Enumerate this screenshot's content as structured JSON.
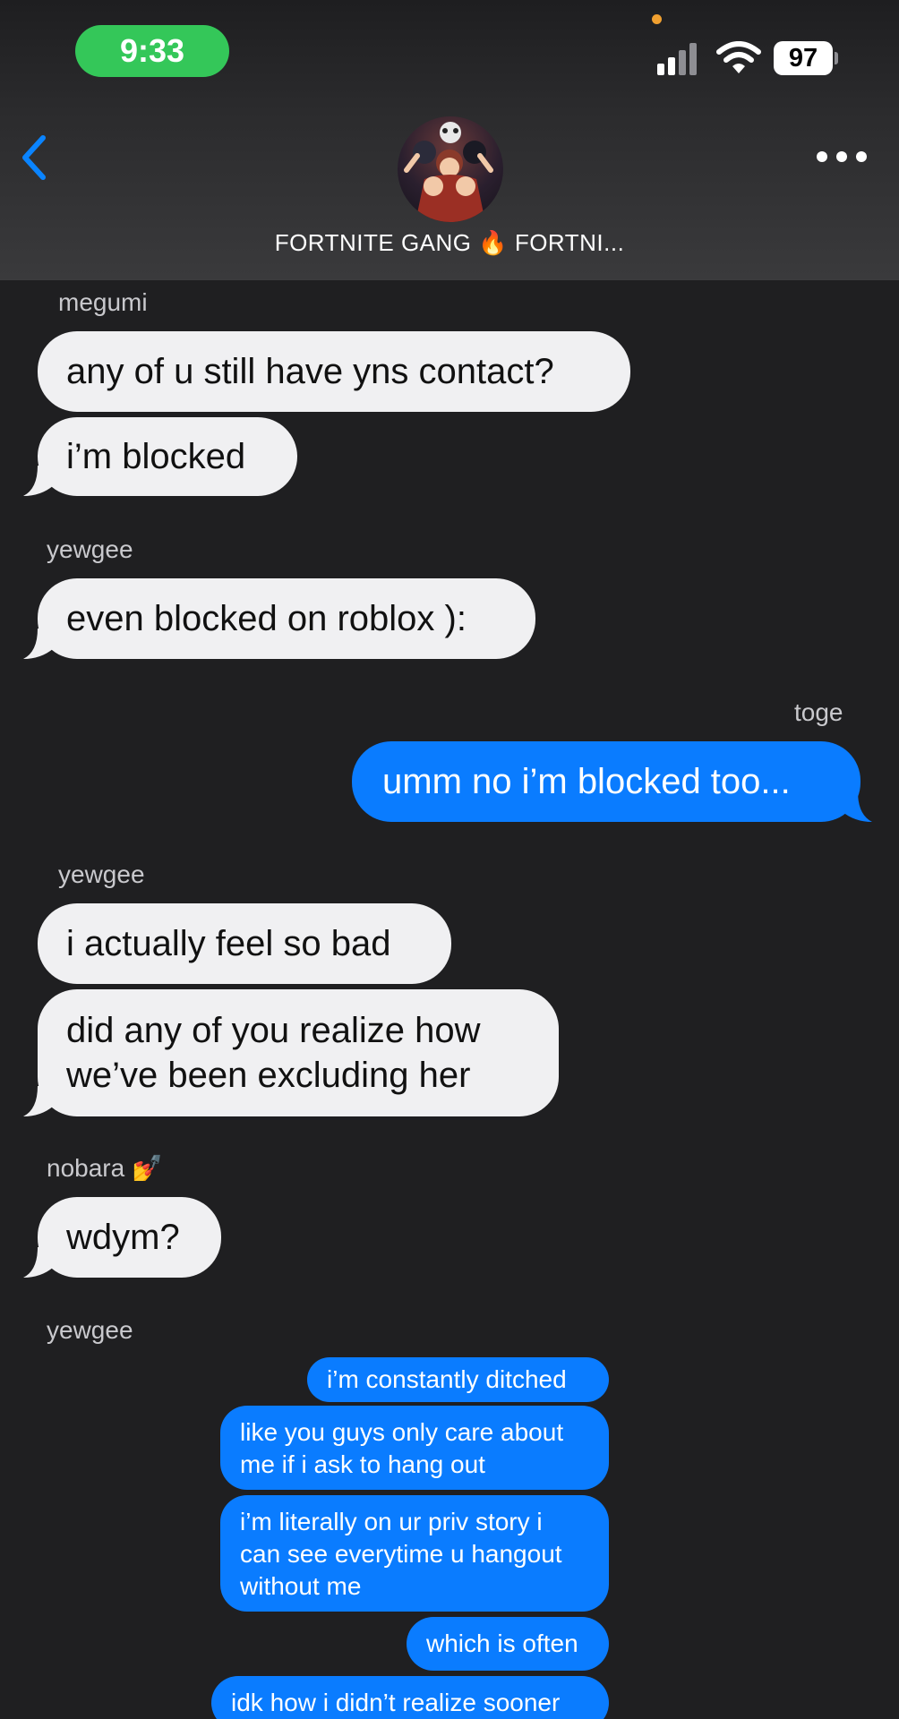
{
  "status_bar": {
    "time": "9:33",
    "battery": "97"
  },
  "header": {
    "group_name": "FORTNITE GANG 🔥 FORTNI..."
  },
  "messages": [
    {
      "sender": "megumi",
      "bubbles": [
        "any of u still have yns contact?",
        "i’m blocked"
      ],
      "side": "left"
    },
    {
      "sender": "yewgee",
      "bubbles": [
        "even blocked on roblox ):"
      ],
      "side": "left"
    },
    {
      "sender": "toge",
      "bubbles": [
        "umm no i’m blocked too..."
      ],
      "side": "right"
    },
    {
      "sender": "yewgee",
      "bubbles": [
        "i actually feel so bad",
        "did any of you realize how we’ve been excluding her"
      ],
      "side": "left"
    },
    {
      "sender": "nobara 💅",
      "bubbles": [
        "wdym?"
      ],
      "side": "left"
    },
    {
      "sender": "yewgee",
      "bubbles": [
        "i’m constantly ditched",
        "like you guys only care about me if i ask to hang out",
        "i’m literally on ur priv story i can see everytime u hangout without me",
        "which is often",
        "idk how i didn’t realize sooner"
      ],
      "side": "embedded"
    }
  ],
  "colors": {
    "incoming_bubble": "#f0f0f2",
    "outgoing_bubble": "#0a7cff",
    "background": "#1f1f21",
    "accent": "#0a84ff",
    "time_pill": "#34c759"
  }
}
